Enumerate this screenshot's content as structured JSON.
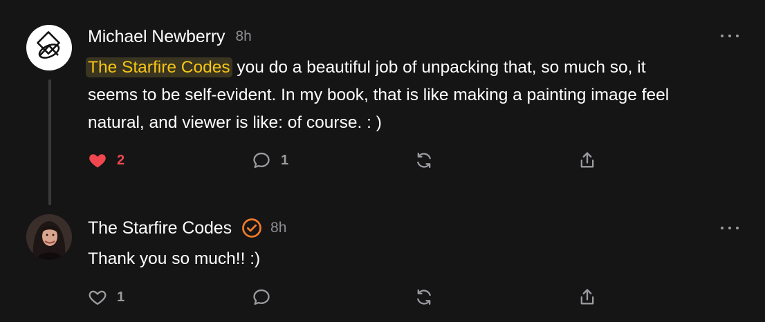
{
  "comments": [
    {
      "author": "Michael Newberry",
      "time": "8h",
      "avatar_icon": "overlapping-shapes-logo-icon",
      "mention": "The Starfire Codes",
      "text_line1": " you do a beautiful job of unpacking that, so much so, it",
      "text_line2": "seems to be self-evident. In my book, that is like making a painting image feel",
      "text_line3": "natural, and viewer is like: of course. : )",
      "likes": "2",
      "liked": true,
      "replies": "1"
    },
    {
      "author": "The Starfire Codes",
      "time": "8h",
      "verified_icon": "verified-badge-icon",
      "text": "Thank you so much!! :)",
      "likes": "1",
      "liked": false,
      "replies": ""
    }
  ],
  "colors": {
    "background": "#151516",
    "like_active": "#f0474f",
    "mention_text": "#f5c518",
    "mention_bg": "#3a3520",
    "verified": "#f07a2b",
    "muted": "#8e8e93"
  }
}
